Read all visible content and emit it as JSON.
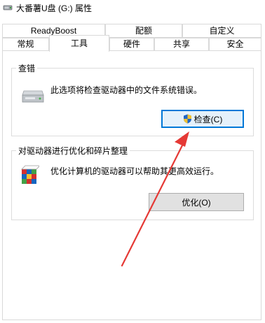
{
  "window": {
    "title": "大番薯U盘 (G:) 属性"
  },
  "tabs": {
    "row1": [
      "ReadyBoost",
      "配额",
      "自定义"
    ],
    "row2": [
      "常规",
      "工具",
      "硬件",
      "共享",
      "安全"
    ],
    "active": "工具"
  },
  "error_check": {
    "title": "查错",
    "description": "此选项将检查驱动器中的文件系统错误。",
    "button_label": "检查(C)"
  },
  "optimize": {
    "title": "对驱动器进行优化和碎片整理",
    "description": "优化计算机的驱动器可以帮助其更高效运行。",
    "button_label": "优化(O)"
  },
  "icons": {
    "window": "usb-drive-icon",
    "drive": "drive-icon",
    "shield": "uac-shield-icon",
    "defrag": "defrag-icon"
  },
  "colors": {
    "accent": "#0078d7",
    "annotation_arrow": "#e53935"
  }
}
